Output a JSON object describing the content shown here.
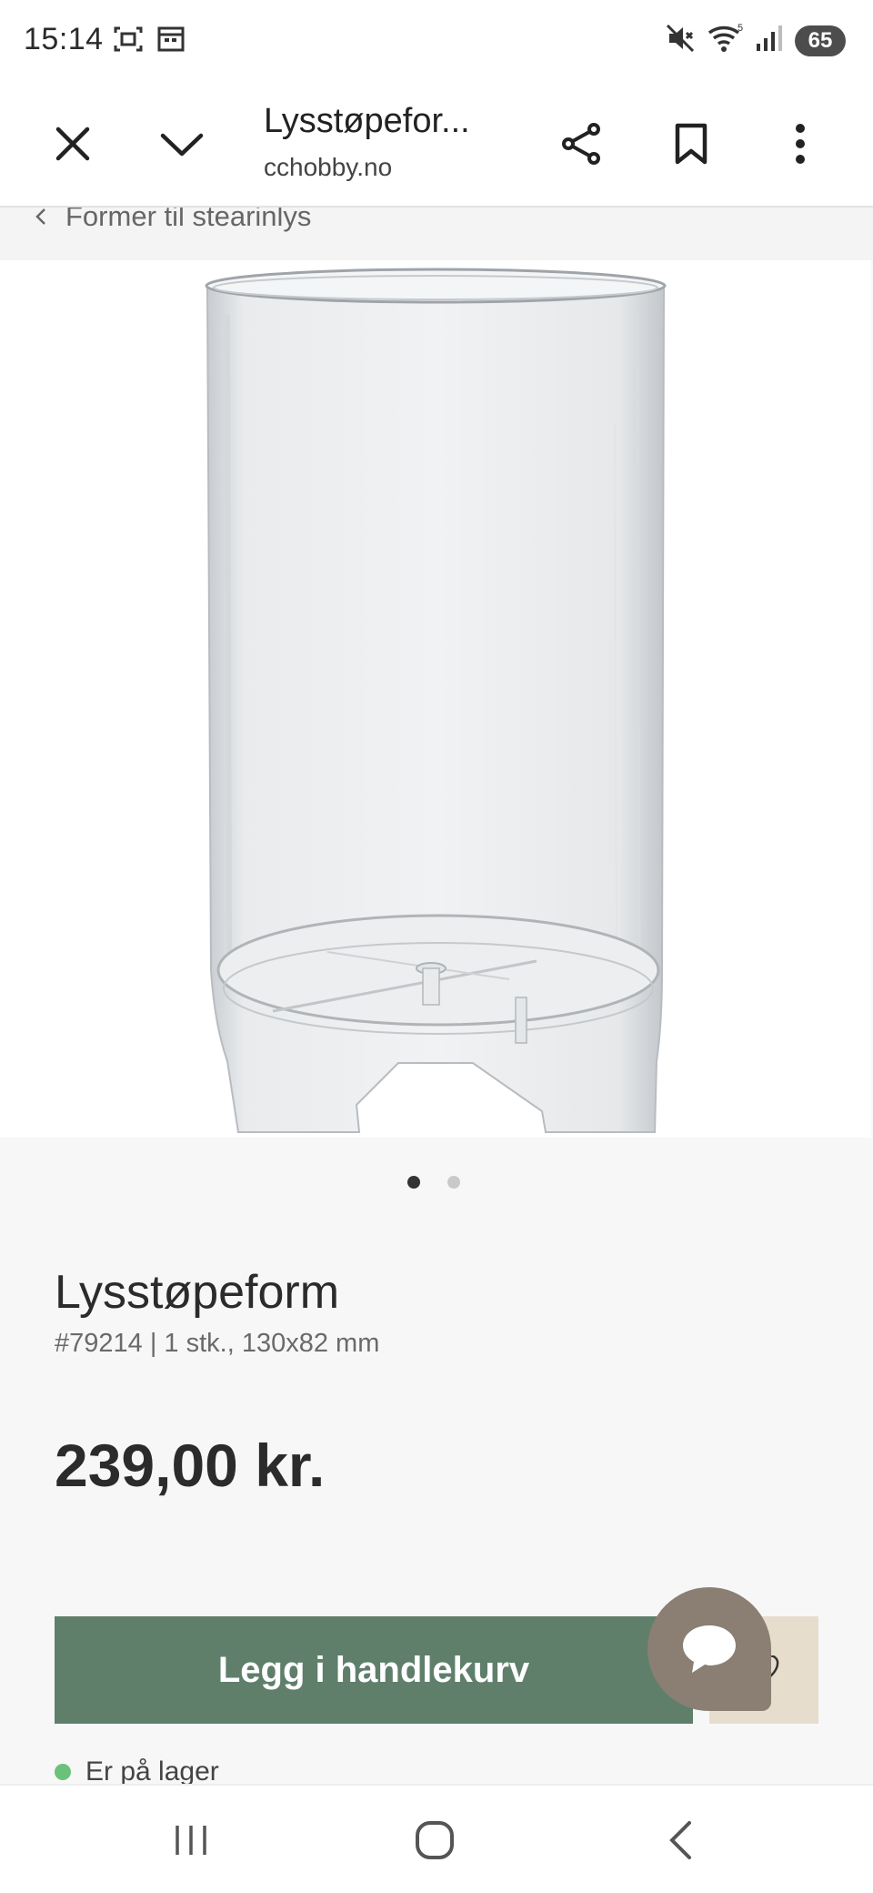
{
  "status_bar": {
    "time": "15:14",
    "battery": "65",
    "icons": [
      "screenshot-icon",
      "calendar-icon",
      "mute-icon",
      "wifi-icon",
      "signal-icon"
    ]
  },
  "toolbar": {
    "title": "Lysstøpefor...",
    "url": "cchobby.no"
  },
  "breadcrumb": {
    "label": "Former til stearinlys"
  },
  "gallery": {
    "total": 2,
    "active_index": 0
  },
  "product": {
    "name": "Lysstøpeform",
    "meta": "#79214 | 1 stk., 130x82 mm",
    "price": "239,00 kr.",
    "add_to_cart_label": "Legg i handlekurv",
    "stock_label": "Er på lager"
  },
  "colors": {
    "cart_button": "#5f7f6b",
    "wishlist_button": "#e7ddcc",
    "chat_button": "#8a7f72",
    "in_stock": "#6cc17a"
  }
}
